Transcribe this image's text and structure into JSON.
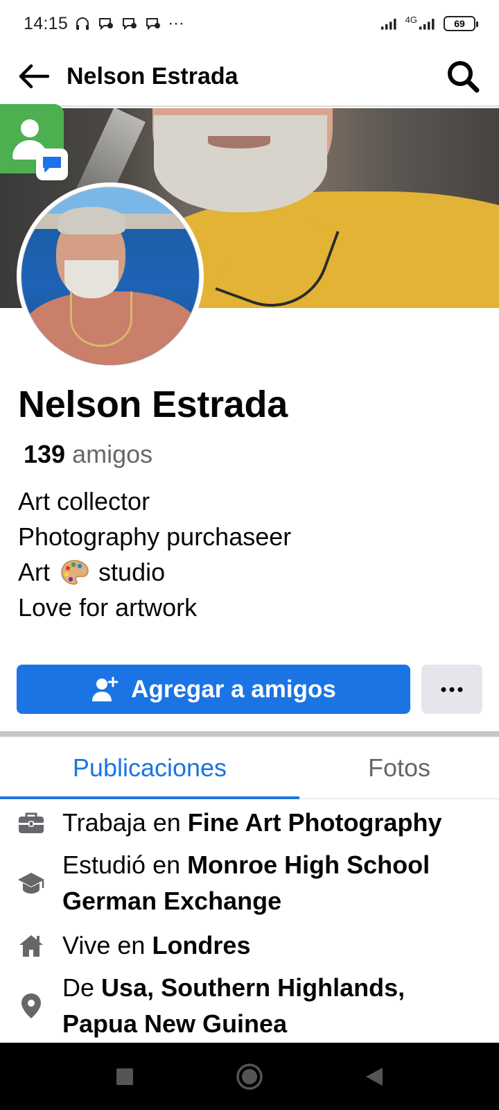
{
  "status_bar": {
    "time": "14:15",
    "more": "···",
    "network_label": "4G",
    "battery": "69"
  },
  "header": {
    "title": "Nelson Estrada"
  },
  "profile": {
    "name": "Nelson Estrada",
    "friends_count": "139",
    "friends_label": "amigos",
    "bio": {
      "line1": "Art collector",
      "line2": "Photography purchaseer",
      "line3_start": "Art",
      "line3_end": "studio",
      "line4": "Love for artwork"
    }
  },
  "actions": {
    "add_friend_label": "Agregar a amigos",
    "more_label": "···"
  },
  "tabs": [
    {
      "label": "Publicaciones",
      "active": true
    },
    {
      "label": "Fotos",
      "active": false
    }
  ],
  "details": {
    "work": {
      "prefix": "Trabaja en",
      "value": "Fine Art Photography"
    },
    "education": {
      "prefix": "Estudió en",
      "value_line1": "Monroe High School",
      "value_line2": "German Exchange"
    },
    "lives": {
      "prefix": "Vive en",
      "value": "Londres"
    },
    "from": {
      "prefix": "De",
      "value_line1": "Usa, Southern Highlands,",
      "value_line2": "Papua New Guinea"
    }
  },
  "colors": {
    "accent": "#1b74e4",
    "secondary_button": "#e4e6eb",
    "muted_text": "#65676b"
  }
}
